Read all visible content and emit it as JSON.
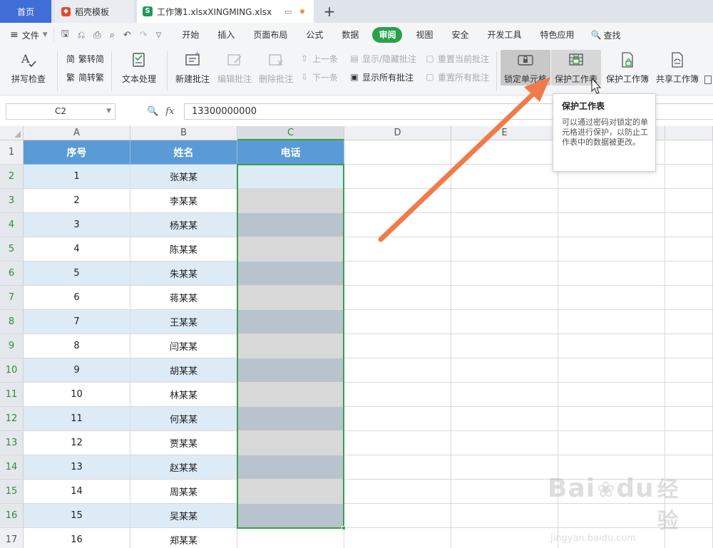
{
  "tabs": {
    "home": "首页",
    "template": "稻壳模板",
    "document": "工作簿1.xlsxXINGMING.xlsx",
    "add": "+"
  },
  "menu": {
    "file": "文件",
    "items": [
      "开始",
      "插入",
      "页面布局",
      "公式",
      "数据",
      "审阅",
      "视图",
      "安全",
      "开发工具",
      "特色应用"
    ],
    "active": "审阅",
    "search": "查找"
  },
  "ribbon": {
    "spellcheck": "拼写检查",
    "trad_to_simp": "繁转简",
    "simp_to_trad": "简转繁",
    "text_processing": "文本处理",
    "new_comment": "新建批注",
    "edit_comment": "编辑批注",
    "delete_comment": "删除批注",
    "prev": "上一条",
    "next": "下一条",
    "show_hide_comment": "显示/隐藏批注",
    "show_all_comments": "显示所有批注",
    "reset_current_comment": "重置当前批注",
    "reset_all_comments": "重置所有批注",
    "lock_cells": "锁定单元格",
    "protect_sheet": "保护工作表",
    "protect_workbook": "保护工作簿",
    "share_workbook": "共享工作簿"
  },
  "formula_bar": {
    "name_box": "C2",
    "fx": "fx",
    "value": "13300000000"
  },
  "sheet": {
    "columns": [
      "A",
      "B",
      "C",
      "D",
      "E"
    ],
    "rows": [
      "1",
      "2",
      "3",
      "4",
      "5",
      "6",
      "7",
      "8",
      "9",
      "10",
      "11",
      "12",
      "13",
      "14",
      "15",
      "16",
      "17"
    ],
    "header": {
      "a": "序号",
      "b": "姓名",
      "c": "电话"
    },
    "data": [
      {
        "no": "1",
        "name": "张某某"
      },
      {
        "no": "2",
        "name": "李某某"
      },
      {
        "no": "3",
        "name": "杨某某"
      },
      {
        "no": "4",
        "name": "陈某某"
      },
      {
        "no": "5",
        "name": "朱某某"
      },
      {
        "no": "6",
        "name": "蒋某某"
      },
      {
        "no": "7",
        "name": "王某某"
      },
      {
        "no": "8",
        "name": "闫某某"
      },
      {
        "no": "9",
        "name": "胡某某"
      },
      {
        "no": "10",
        "name": "林某某"
      },
      {
        "no": "11",
        "name": "何某某"
      },
      {
        "no": "12",
        "name": "贾某某"
      },
      {
        "no": "13",
        "name": "赵某某"
      },
      {
        "no": "14",
        "name": "周某某"
      },
      {
        "no": "15",
        "name": "吴某某"
      },
      {
        "no": "16",
        "name": "郑某某"
      }
    ]
  },
  "tooltip": {
    "title": "保护工作表",
    "body": "可以通过密码对锁定的单元格进行保护，以防止工作表中的数据被更改。"
  },
  "watermark": {
    "main": "Bai",
    "cn": "经验",
    "sub": "jingyan.baidu.com"
  },
  "colors": {
    "accent_green": "#2aa04a",
    "header_blue": "#5b9bd5",
    "band_blue": "#ddebf7",
    "arrow_orange": "#f07b4a",
    "tab_blue": "#3f6fd6"
  },
  "icons": [
    "spellcheck-icon",
    "trad-simp-icon",
    "text-process-icon",
    "new-comment-icon",
    "edit-comment-icon",
    "delete-comment-icon",
    "lock-cell-icon",
    "protect-sheet-icon",
    "protect-workbook-icon",
    "share-workbook-icon",
    "search-icon",
    "zoom-icon",
    "save-icon",
    "print-icon",
    "undo-icon",
    "redo-icon"
  ]
}
